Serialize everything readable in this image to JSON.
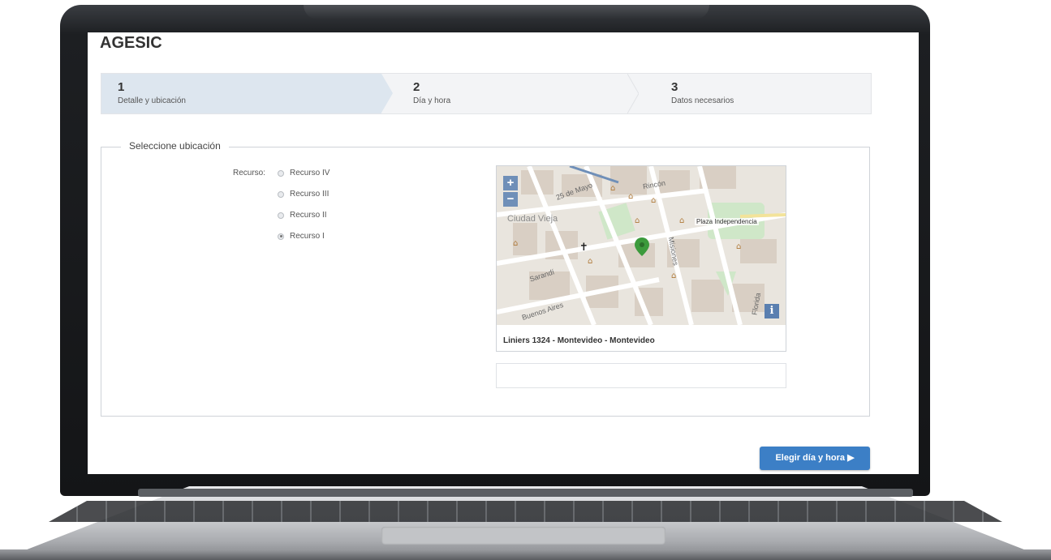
{
  "app": {
    "title": "AGESIC"
  },
  "steps": [
    {
      "number": "1",
      "label": "Detalle y ubicación",
      "active": true
    },
    {
      "number": "2",
      "label": "Día y hora",
      "active": false
    },
    {
      "number": "3",
      "label": "Datos necesarios",
      "active": false
    }
  ],
  "location": {
    "legend": "Seleccione ubicación",
    "resource_label": "Recurso:",
    "resources": [
      {
        "label": "Recurso IV",
        "selected": false
      },
      {
        "label": "Recurso III",
        "selected": false
      },
      {
        "label": "Recurso II",
        "selected": false
      },
      {
        "label": "Recurso I",
        "selected": true
      }
    ]
  },
  "map": {
    "zoom_in": "+",
    "zoom_out": "−",
    "info": "i",
    "labels": {
      "ciudad_vieja": "Ciudad Vieja",
      "plaza": "Plaza Independencia",
      "buenos_aires": "Buenos Aires",
      "sarandi": "Sarandí",
      "rincon": "Rincón",
      "mayo": "25 de Mayo",
      "misiones": "Misiones",
      "florida": "Florida"
    },
    "address": "Liniers 1324 - Montevideo - Montevideo",
    "marker_color": "#3c9a3c"
  },
  "address_input": {
    "value": ""
  },
  "actions": {
    "next": "Elegir día y hora ▶"
  },
  "colors": {
    "primary": "#3c7fc6",
    "active_step": "#dde6ef"
  }
}
